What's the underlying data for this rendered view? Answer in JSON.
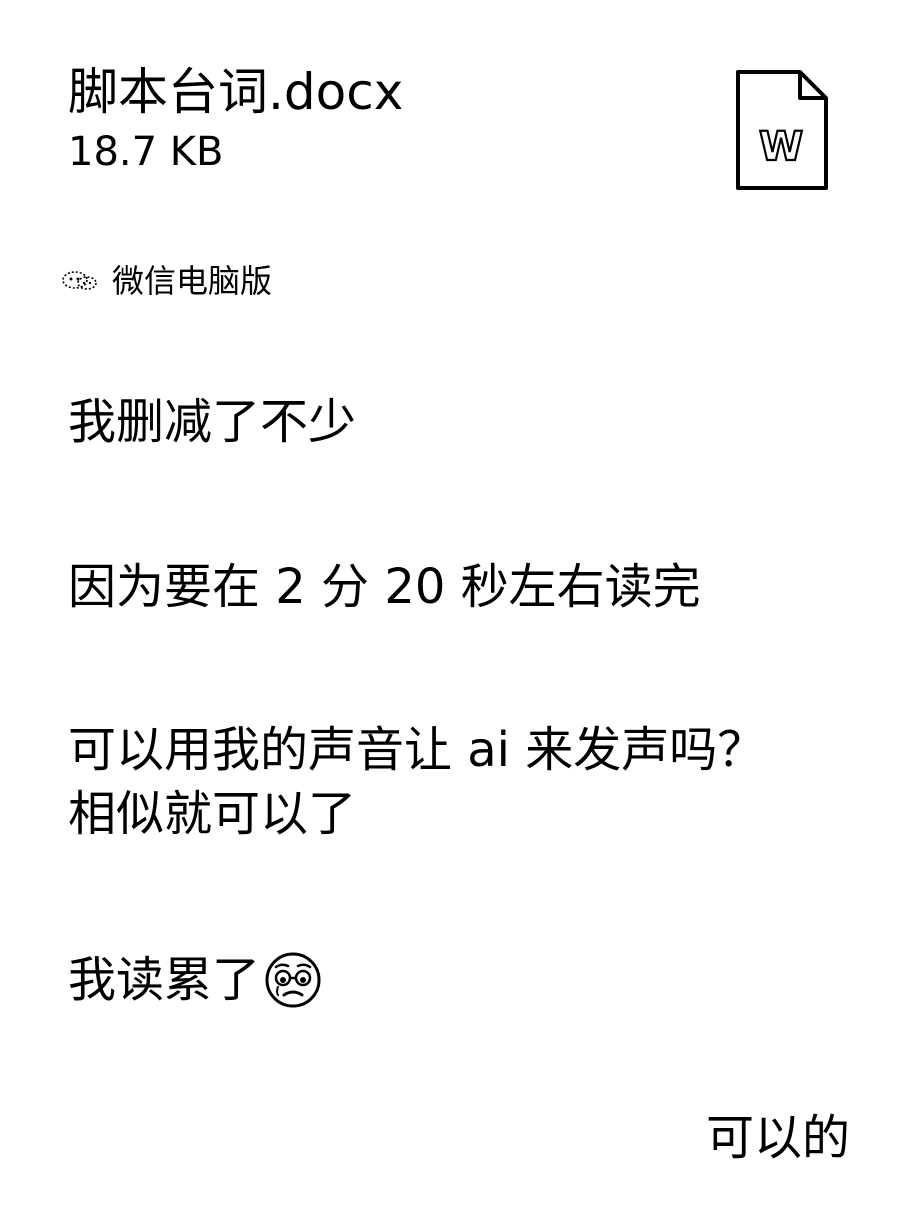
{
  "file": {
    "name": "脚本台词.docx",
    "size": "18.7 KB",
    "icon": "word-document-icon",
    "icon_letter": "W"
  },
  "source": {
    "icon": "wechat-icon",
    "label": "微信电脑版"
  },
  "messages": [
    {
      "text": "我删减了不少"
    },
    {
      "text": "因为要在 2 分 20 秒左右读完"
    },
    {
      "line1": "可以用我的声音让 ai 来发声吗？",
      "line2": "相似就可以了"
    },
    {
      "text": "我读累了",
      "emoji": "tired-face-emoji"
    }
  ],
  "reply": {
    "text": "可以的"
  }
}
